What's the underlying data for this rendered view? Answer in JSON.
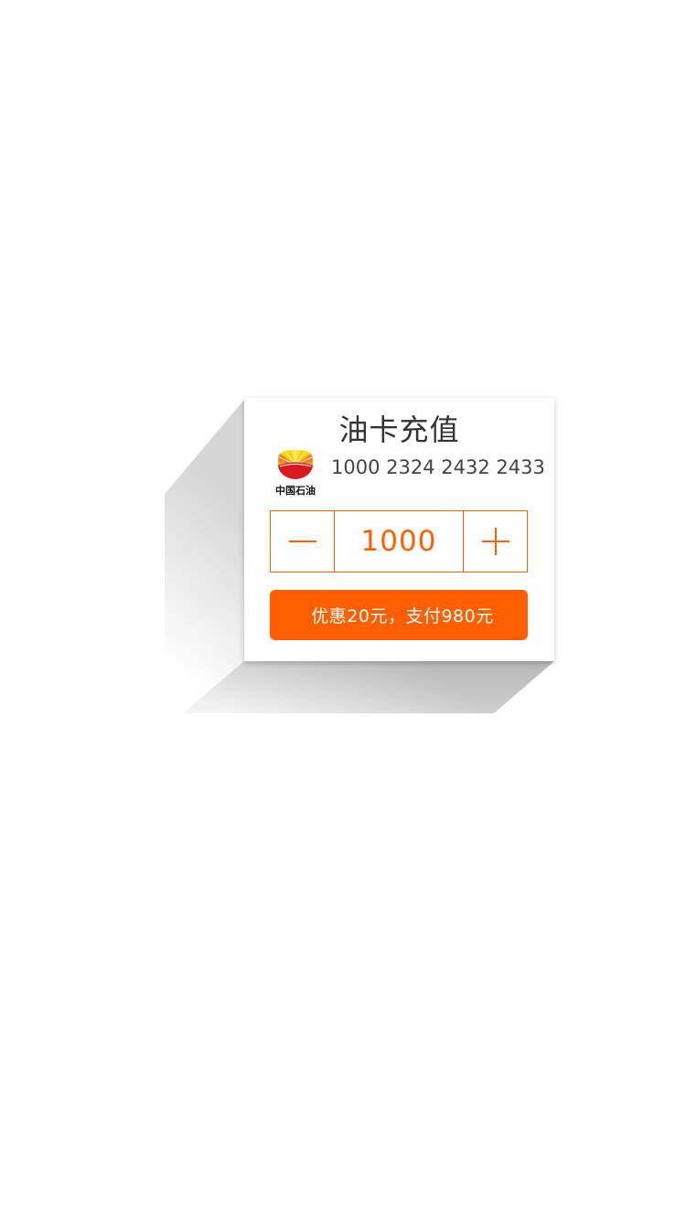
{
  "card": {
    "title": "油卡充值",
    "logo_text": "中国石油",
    "card_number": "1000 2324 2432 2433"
  },
  "stepper": {
    "value": "1000"
  },
  "pay_button": {
    "label": "优惠20元，支付980元"
  },
  "colors": {
    "accent": "#ff5f00",
    "text": "#333333",
    "logo_red": "#d71920",
    "logo_yellow": "#ffd200"
  },
  "icons": {
    "minus": "minus-icon",
    "plus": "plus-icon",
    "logo": "petrochina-logo-icon"
  }
}
